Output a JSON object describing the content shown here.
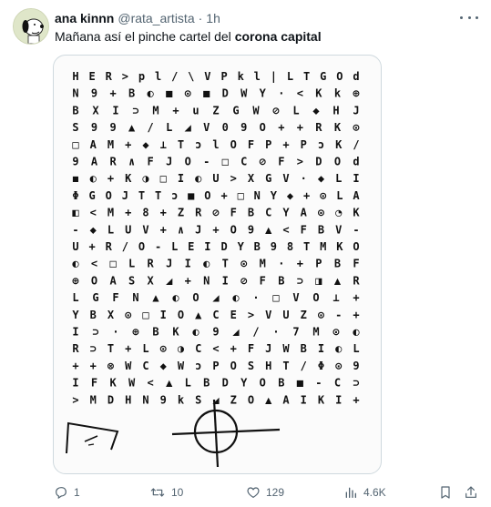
{
  "tweet": {
    "author_name": "ana kinnn",
    "author_handle": "@rata_artista",
    "separator": "·",
    "time": "1h",
    "text_prefix": "Mañana así el pinche cartel del ",
    "text_bold": "corona capital"
  },
  "cipher_rows": [
    "HER>pl/\\VPkl|LTGOd",
    "N9+B◐■⊙■DWY·<Kk⊕",
    "BXI⊃M+uZGW⊘L◆HJ",
    "S99▲/L◢V09O++RK⊙",
    "□AM+◆⊥TɔlOFP+PɔK/",
    "9AR∧FJO-□C⊘F>DOd",
    "◼◐+K◑□I◐U>XGV·◆LI",
    "ΦGOJTTɔ■O+□NY◆+⊙LA",
    "◧<M+8+ZR⊘FBCYA⊙◔K",
    "-◆LUV+∧J+O9▲<FBV-",
    "U+R/O-LEIDYB98TMKO",
    "◐<□LRJI◐T⊙M·+PBF",
    "⊕OASX◢+NI⊘FB⊃◨▲R",
    "LGFN▲◐O◢◐·□VO⊥+",
    "YBX⊙□IO▲CE>VUZ⊙-+",
    "I⊃·⊕BK◐9◢/·7M⊙◐",
    "R⊃T+L⊙◑C<+FJWBI◐L",
    "++⊗WC◆WɔPOSHT/Φ⊙9",
    "IFKW<▲LBDYOB■-C⊃",
    ">MDHN9kS◢ZO▲AIKI+"
  ],
  "footer": {
    "replies": "1",
    "retweets": "10",
    "likes": "129",
    "views": "4.6K"
  },
  "colors": {
    "text_primary": "#0f1419",
    "text_secondary": "#536471",
    "border": "#cfd9de"
  },
  "icons": {
    "more": "more-dots-icon",
    "reply": "reply-icon",
    "retweet": "retweet-icon",
    "like": "heart-icon",
    "views": "views-chart-icon",
    "bookmark": "bookmark-icon",
    "share": "share-icon"
  }
}
